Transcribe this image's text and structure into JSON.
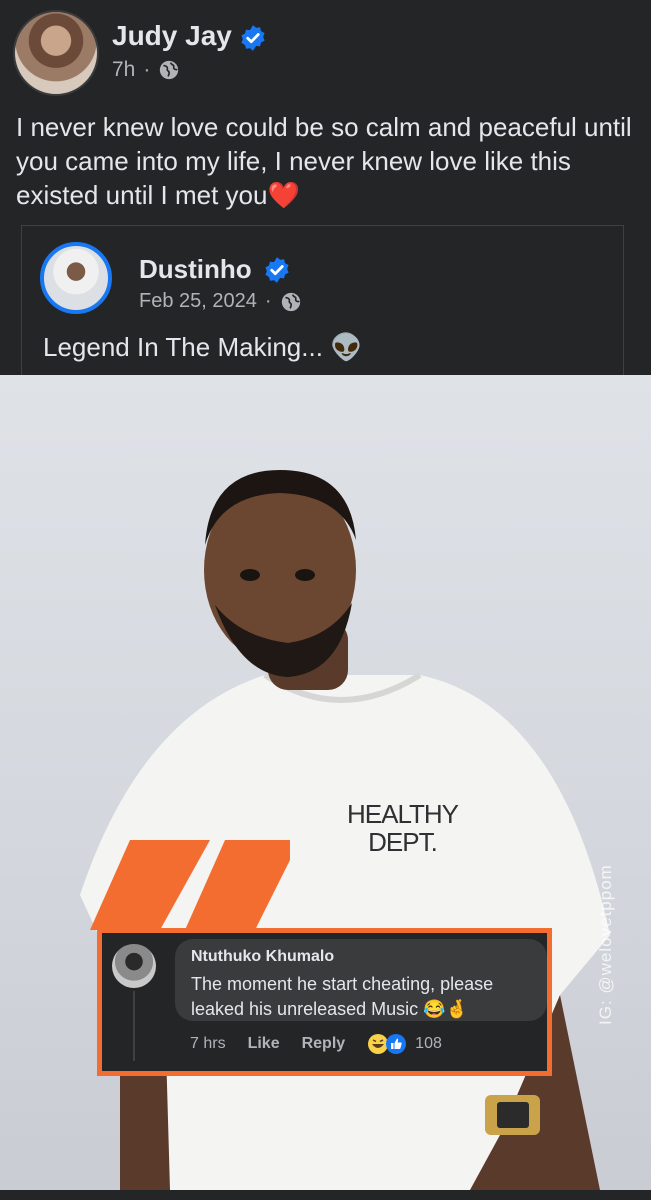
{
  "post": {
    "author": "Judy Jay",
    "time": "7h",
    "separator": "·",
    "text": "I never knew love could be so calm and peaceful until you came into my life, I never knew love like this existed until I met you❤️"
  },
  "shared_post": {
    "author": "Dustinho",
    "date": "Feb 25, 2024",
    "separator": "·",
    "text": "Legend In The Making... 👽"
  },
  "photo": {
    "watermark": "IG: @welovetppom",
    "shirt_text_line1": "HEALTHY",
    "shirt_text_line2": "DEPT."
  },
  "comment": {
    "name": "Ntuthuko Khumalo",
    "text": "The moment he start cheating, please leaked his unreleased Music 😂🤞",
    "time": "7 hrs",
    "like": "Like",
    "reply": "Reply",
    "reaction_count": "108"
  },
  "colors": {
    "background": "#242526",
    "verified_blue": "#1877f2",
    "highlight_orange": "#f26d2f"
  },
  "icons": [
    "verified-badge-icon",
    "globe-icon",
    "haha-reaction-icon",
    "like-reaction-icon",
    "quote-mark-icon"
  ]
}
